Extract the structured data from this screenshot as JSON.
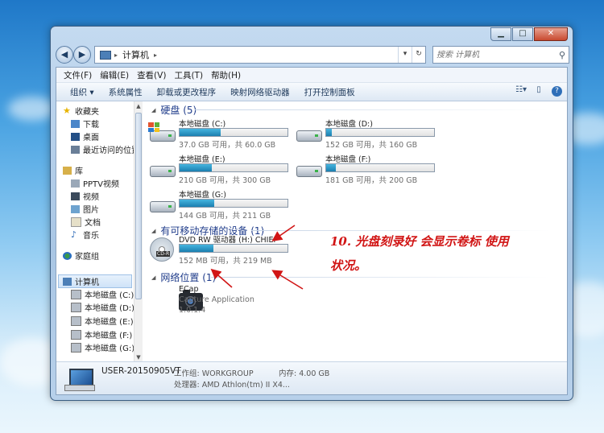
{
  "window": {
    "caption_buttons": [
      "minimize",
      "maximize",
      "close"
    ]
  },
  "address_bar": {
    "path": "计算机",
    "search_placeholder": "搜索 计算机"
  },
  "menu": [
    "文件(F)",
    "编辑(E)",
    "查看(V)",
    "工具(T)",
    "帮助(H)"
  ],
  "toolbar": [
    "组织 ▾",
    "系统属性",
    "卸载或更改程序",
    "映射网络驱动器",
    "打开控制面板"
  ],
  "nav": {
    "favorites": "收藏夹",
    "favorites_items": [
      "下载",
      "桌面",
      "最近访问的位置"
    ],
    "libraries": "库",
    "library_items": [
      "PPTV视频",
      "视频",
      "图片",
      "文档",
      "音乐"
    ],
    "homegroup": "家庭组",
    "computer": "计算机",
    "computer_items": [
      "本地磁盘 (C:)",
      "本地磁盘 (D:)",
      "本地磁盘 (E:)",
      "本地磁盘 (F:)",
      "本地磁盘 (G:)"
    ]
  },
  "groups": {
    "hard_disks": "硬盘 (5)",
    "removable": "有可移动存储的设备 (1)",
    "network": "网络位置 (1)"
  },
  "drives": [
    {
      "name": "本地磁盘 (C:)",
      "size": "37.0 GB 可用，共 60.0 GB",
      "used_fraction": 0.38
    },
    {
      "name": "本地磁盘 (D:)",
      "size": "152 GB 可用，共 160 GB",
      "used_fraction": 0.05
    },
    {
      "name": "本地磁盘 (E:)",
      "size": "210 GB 可用，共 300 GB",
      "used_fraction": 0.3
    },
    {
      "name": "本地磁盘 (F:)",
      "size": "181 GB 可用，共 200 GB",
      "used_fraction": 0.09
    },
    {
      "name": "本地磁盘 (G:)",
      "size": "144 GB 可用，共 211 GB",
      "used_fraction": 0.32
    }
  ],
  "dvd": {
    "name": "DVD RW 驱动器 (H:) CHIEF",
    "size": "152 MB 可用，共 219 MB",
    "used_fraction": 0.31,
    "badge": "CD-R"
  },
  "network_item": {
    "name": "ECap",
    "subtitle": "Capture Application",
    "version": "1.0.1.4"
  },
  "details": {
    "computer_name": "USER-20150905VT",
    "workgroup": "工作组: WORKGROUP",
    "memory": "内存: 4.00 GB",
    "processor": "处理器: AMD Athlon(tm) II X4..."
  },
  "annotation": {
    "line1": "10. 光盘刻录好  会显示卷标 使用",
    "line2": "状况。",
    "color": "#d11515"
  }
}
